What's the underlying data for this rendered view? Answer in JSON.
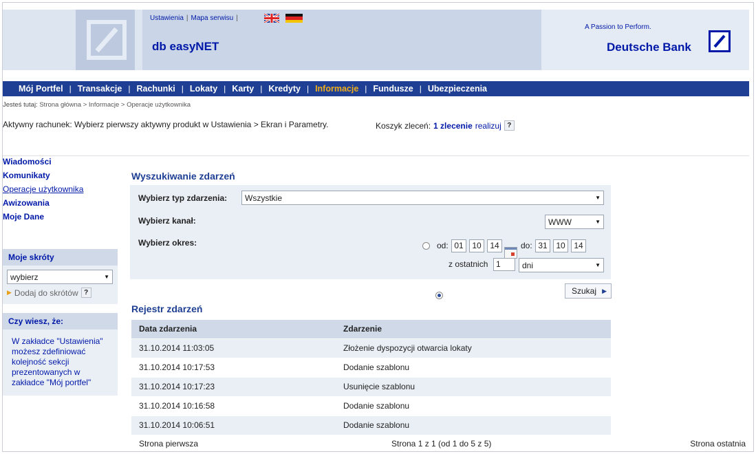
{
  "header": {
    "links": [
      "Ustawienia",
      "Mapa serwisu"
    ],
    "app_name": "db easyNET",
    "slogan": "A Passion to Perform.",
    "brand": "Deutsche Bank",
    "brand_color": "#0018a8"
  },
  "nav": {
    "items": [
      "Mój Portfel",
      "Transakcje",
      "Rachunki",
      "Lokaty",
      "Karty",
      "Kredyty",
      "Informacje",
      "Fundusze",
      "Ubezpieczenia"
    ],
    "active": "Informacje",
    "active_color": "#f0ad1c"
  },
  "breadcrumb": {
    "prefix": "Jesteś tutaj:",
    "items": [
      "Strona główna",
      "Informacje",
      "Operacje użytkownika"
    ]
  },
  "account": {
    "text": "Aktywny rachunek:  Wybierz pierwszy aktywny produkt w Ustawienia > Ekran i Parametry."
  },
  "basket": {
    "label": "Koszyk zleceń:",
    "count": "1 zlecenie",
    "action": "realizuj",
    "help": "?"
  },
  "sidebar": {
    "links": [
      "Wiadomości",
      "Komunikaty",
      "Operacje użytkownika",
      "Awizowania",
      "Moje Dane"
    ],
    "current": "Operacje użytkownika",
    "shortcuts": {
      "title": "Moje skróty",
      "select_value": "wybierz",
      "add_label": "Dodaj do skrótów",
      "help": "?"
    },
    "tip": {
      "title": "Czy wiesz, że:",
      "text": "W zakładce \"Ustawienia\" możesz zdefiniować kolejność sekcji prezentowanych w zakładce \"Mój portfel\""
    }
  },
  "search": {
    "title": "Wyszukiwanie zdarzeń",
    "type_label": "Wybierz typ zdarzenia:",
    "type_value": "Wszystkie",
    "channel_label": "Wybierz kanał:",
    "channel_value": "WWW",
    "period_label": "Wybierz okres:",
    "from_label": "od:",
    "from": [
      "01",
      "10",
      "14"
    ],
    "to_label": "do:",
    "to": [
      "31",
      "10",
      "14"
    ],
    "last_label": "z ostatnich",
    "last_value": "1",
    "unit_value": "dni",
    "selected_period_mode": "z ostatnich",
    "button": "Szukaj"
  },
  "register": {
    "title": "Rejestr zdarzeń",
    "columns": [
      "Data zdarzenia",
      "Zdarzenie"
    ],
    "rows": [
      [
        "31.10.2014 11:03:05",
        "Złożenie dyspozycji otwarcia lokaty"
      ],
      [
        "31.10.2014 10:17:53",
        "Dodanie szablonu"
      ],
      [
        "31.10.2014 10:17:23",
        "Usunięcie szablonu"
      ],
      [
        "31.10.2014 10:16:58",
        "Dodanie szablonu"
      ],
      [
        "31.10.2014 10:06:51",
        "Dodanie szablonu"
      ]
    ]
  },
  "pager": {
    "first": "Strona pierwsza",
    "info": "Strona 1 z 1 (od 1 do 5 z 5)",
    "last": "Strona ostatnia"
  }
}
